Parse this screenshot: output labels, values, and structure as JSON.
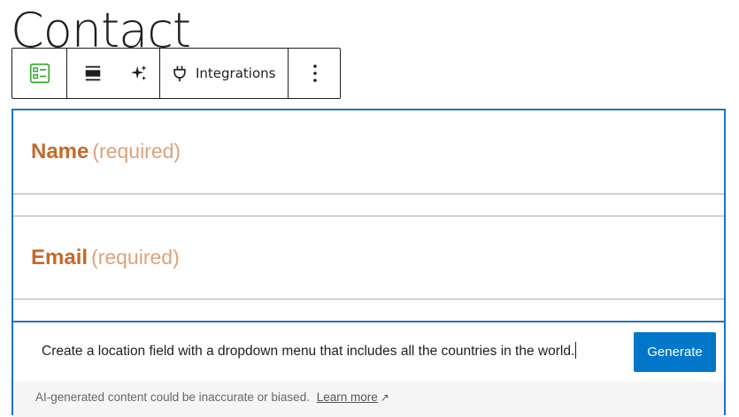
{
  "page": {
    "title": "Contact"
  },
  "toolbar": {
    "form_icon": "form-block-icon",
    "align_icon": "align-icon",
    "sparkle_icon": "ai-sparkle-icon",
    "integrations_icon": "plug-icon",
    "integrations_label": "Integrations",
    "more_icon": "more-vertical-icon"
  },
  "form": {
    "fields": [
      {
        "label": "Name",
        "required_text": "(required)"
      },
      {
        "label": "Email",
        "required_text": "(required)"
      }
    ]
  },
  "ai": {
    "prompt_value": "Create a location field with a dropdown menu that includes all the countries in the world.",
    "generate_label": "Generate",
    "disclaimer": "AI-generated content could be inaccurate or biased.",
    "learn_more": "Learn more"
  },
  "colors": {
    "accent": "#1e73be",
    "button": "#0077c8",
    "label": "#c4692a",
    "required": "#dca27a",
    "form_icon": "#3aa935"
  }
}
